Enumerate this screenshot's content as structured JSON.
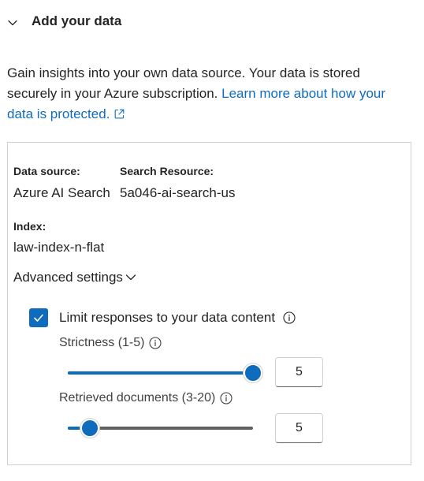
{
  "section": {
    "title": "Add your data"
  },
  "intro": {
    "text": "Gain insights into your own data source. Your data is stored securely in your Azure subscription. ",
    "link_text": "Learn more about how your data is protected."
  },
  "card": {
    "data_source_label": "Data source:",
    "data_source_value": "Azure AI Search",
    "search_resource_label": "Search Resource:",
    "search_resource_value": "5a046-ai-search-us",
    "index_label": "Index:",
    "index_value": "law-index-n-flat",
    "advanced_label": "Advanced settings",
    "limit_label": "Limit responses to your data content",
    "limit_checked": true,
    "strictness": {
      "label": "Strictness (1-5)",
      "value": "5",
      "min": 1,
      "max": 5,
      "level": 5
    },
    "retrieved": {
      "label": "Retrieved documents (3-20)",
      "value": "5",
      "min": 3,
      "max": 20,
      "level": 5
    }
  },
  "colors": {
    "accent": "#0f6cbd",
    "track": "#616161",
    "border": "#d1d1d1"
  }
}
